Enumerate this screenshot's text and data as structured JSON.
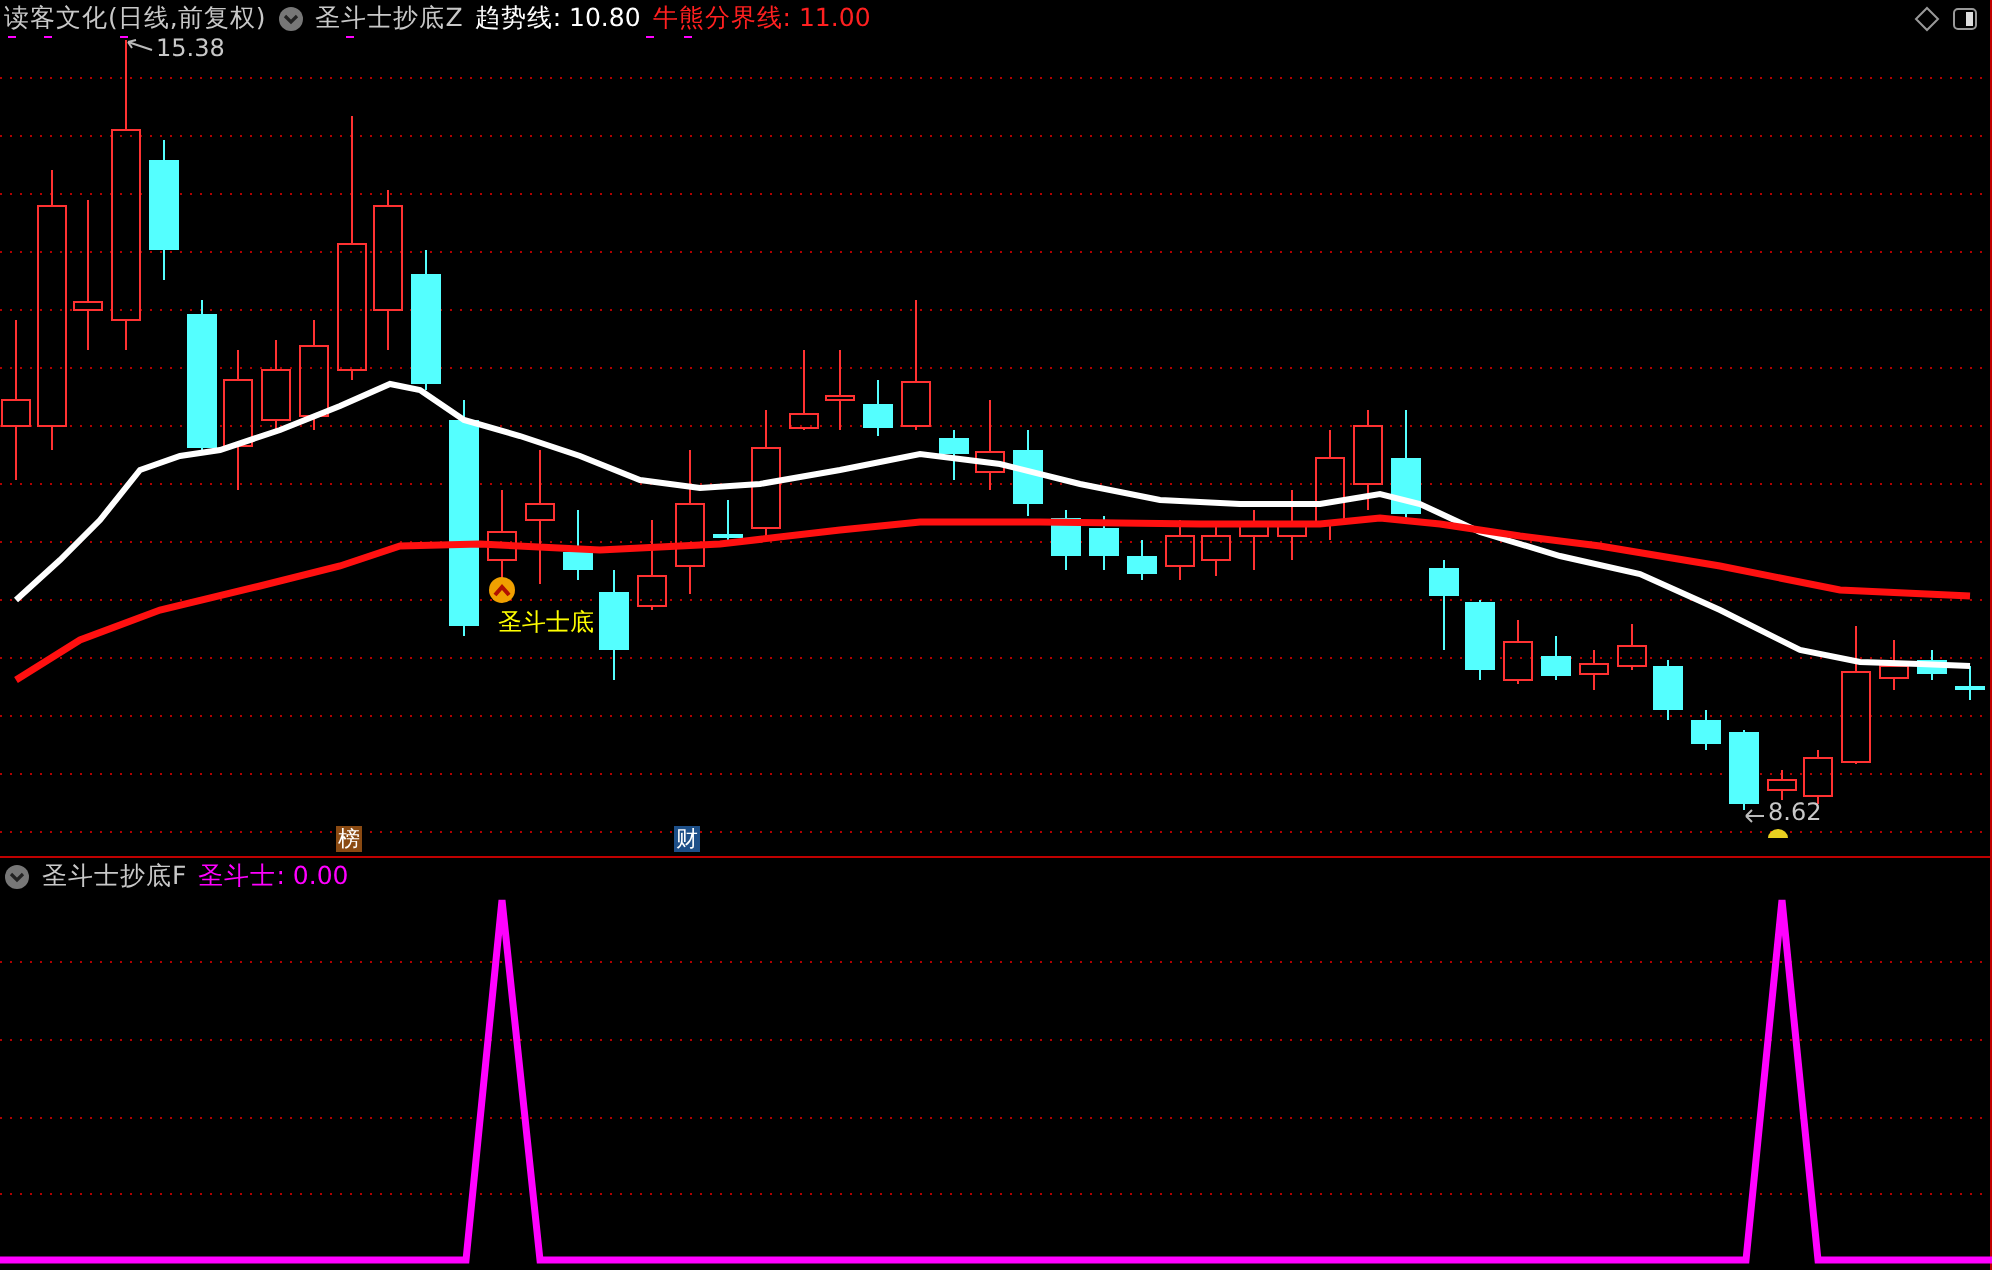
{
  "header": {
    "title": "读客文化(日线,前复权)",
    "indicator": "圣斗士抄底Z",
    "readings": [
      {
        "label": "趋势线: 10.80",
        "color": "#ffffff"
      },
      {
        "label": "牛熊分界线: 11.00",
        "color": "#ff2020"
      }
    ]
  },
  "main_chart": {
    "high_label": "15.38",
    "low_label": "8.62",
    "signal_label": "圣斗士底",
    "badges": [
      {
        "label": "榜",
        "color": "#8a4a12"
      },
      {
        "label": "财",
        "color": "#1d4f88"
      }
    ]
  },
  "sub_panel": {
    "indicator": "圣斗士抄底F",
    "readings": [
      {
        "label": "圣斗士: 0.00",
        "color": "#ff00ff"
      }
    ]
  }
}
